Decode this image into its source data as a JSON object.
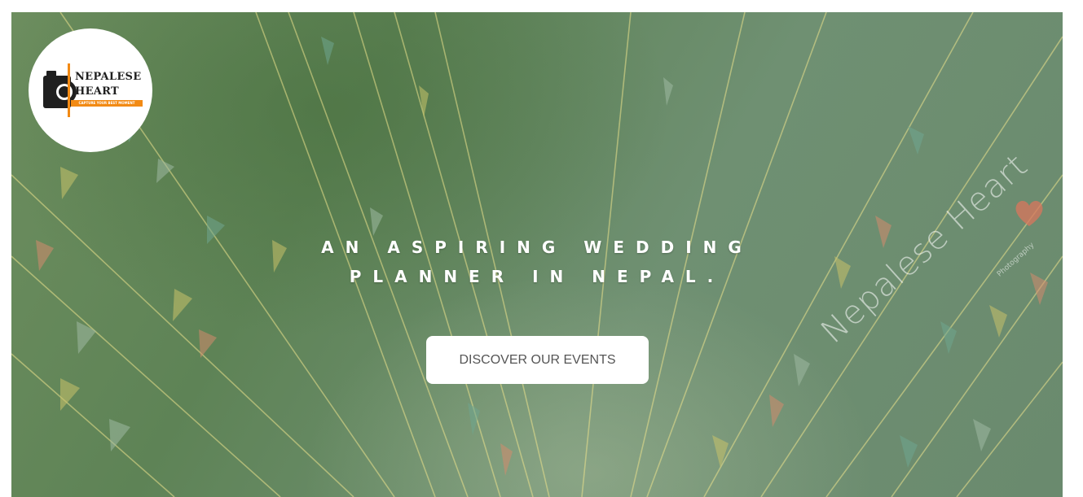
{
  "logo": {
    "line1": "NEPALESE",
    "line2": "HEART",
    "tagline": "CAPTURE YOUR BEST MOMENT",
    "icon": "camera-icon",
    "accent_color": "#f28a14"
  },
  "hero": {
    "headline_line1": "AN ASPIRING WEDDING",
    "headline_line2": "PLANNER IN NEPAL.",
    "cta_label": "DISCOVER OUR EVENTS",
    "overlay_color": "#6a8a62"
  },
  "watermark": {
    "text": "Nepalese Heart",
    "subtext": "Photography",
    "icon": "heart-icon",
    "heart_color": "#d9755c"
  }
}
